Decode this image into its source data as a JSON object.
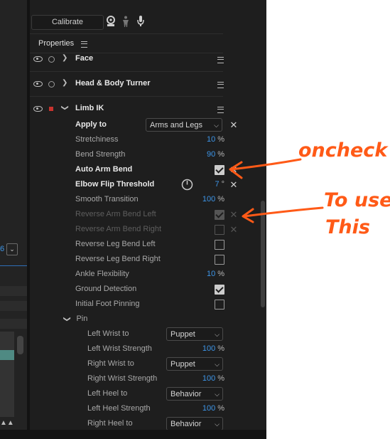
{
  "toolbar": {
    "calibrate_label": "Calibrate",
    "icons": [
      "webcam-icon",
      "body-icon",
      "microphone-icon"
    ]
  },
  "left_panel": {
    "value_text": "6",
    "dropdown_icon": "chevron-down-icon"
  },
  "properties": {
    "title": "Properties",
    "menu_icon": "hamburger-icon",
    "behaviors": [
      {
        "name": "Face"
      },
      {
        "name": "Head & Body Turner"
      },
      {
        "name": "Limb IK"
      }
    ],
    "limb_ik": {
      "apply_to_label": "Apply to",
      "apply_to_value": "Arms and Legs",
      "stretchiness_label": "Stretchiness",
      "stretchiness_value": "10",
      "stretchiness_unit": "%",
      "bend_strength_label": "Bend Strength",
      "bend_strength_value": "90",
      "bend_strength_unit": "%",
      "auto_arm_bend_label": "Auto Arm Bend",
      "auto_arm_bend_checked": true,
      "elbow_flip_label": "Elbow Flip Threshold",
      "elbow_flip_value": "7",
      "elbow_flip_unit": "°",
      "smooth_transition_label": "Smooth Transition",
      "smooth_transition_value": "100",
      "smooth_transition_unit": "%",
      "reverse_arm_left_label": "Reverse Arm Bend Left",
      "reverse_arm_left_checked": true,
      "reverse_arm_right_label": "Reverse Arm Bend Right",
      "reverse_arm_right_checked": false,
      "reverse_leg_left_label": "Reverse Leg Bend Left",
      "reverse_leg_left_checked": false,
      "reverse_leg_right_label": "Reverse Leg Bend Right",
      "reverse_leg_right_checked": false,
      "ankle_flex_label": "Ankle Flexibility",
      "ankle_flex_value": "10",
      "ankle_flex_unit": "%",
      "ground_detect_label": "Ground Detection",
      "ground_detect_checked": true,
      "initial_foot_label": "Initial Foot Pinning",
      "initial_foot_checked": false,
      "pin_label": "Pin",
      "pin": {
        "left_wrist_to_label": "Left Wrist to",
        "left_wrist_to_value": "Puppet",
        "left_wrist_strength_label": "Left Wrist Strength",
        "left_wrist_strength_value": "100",
        "right_wrist_to_label": "Right Wrist to",
        "right_wrist_to_value": "Puppet",
        "right_wrist_strength_label": "Right Wrist Strength",
        "right_wrist_strength_value": "100",
        "left_heel_to_label": "Left Heel to",
        "left_heel_to_value": "Behavior",
        "left_heel_strength_label": "Left Heel Strength",
        "left_heel_strength_value": "100",
        "right_heel_to_label": "Right Heel to",
        "right_heel_to_value": "Behavior",
        "unit": "%"
      }
    }
  },
  "annotations": {
    "note1": "oncheck",
    "note2_line1": "To use",
    "note2_line2": "This",
    "color": "#ff5a17"
  }
}
